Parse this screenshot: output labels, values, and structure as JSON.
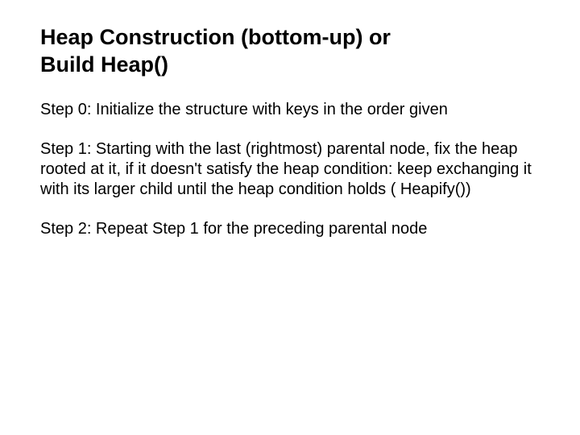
{
  "title_line1": "Heap Construction (bottom-up) or",
  "title_line2": "Build Heap()",
  "step0": "Step 0: Initialize the structure with keys in the order given",
  "step1": "Step 1: Starting with the last (rightmost) parental node, fix the heap rooted at it, if it doesn't satisfy the heap condition: keep exchanging it with its larger child until the heap condition holds ( Heapify())",
  "step2": "Step 2: Repeat Step 1 for the preceding parental node"
}
